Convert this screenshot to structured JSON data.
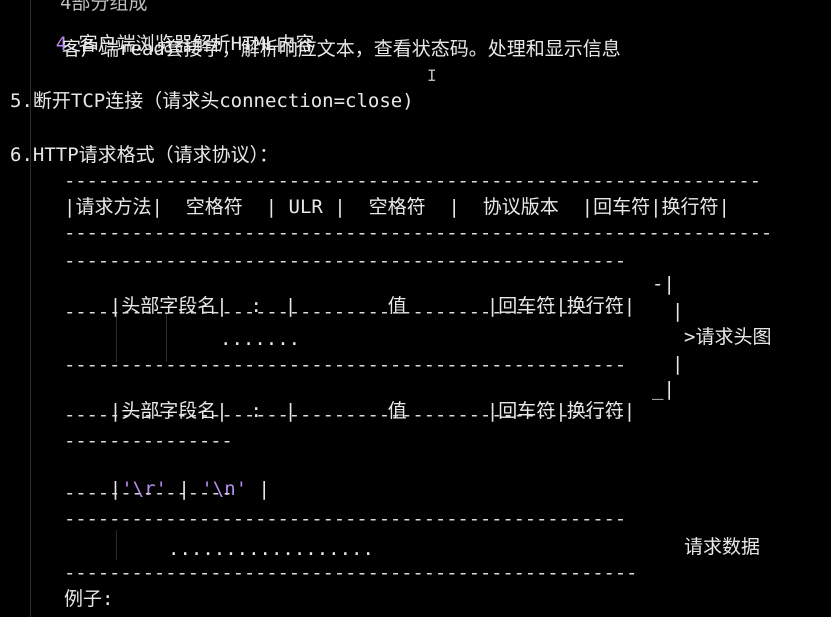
{
  "top_partial": "4部分组成",
  "section4": {
    "number": "4.",
    "title": "客户端浏览器解析HTML内容",
    "body": "客户端read套接字，解析响应文本，查看状态码。处理和显示信息"
  },
  "section5": {
    "text": "5.断开TCP连接（请求头connection=close)"
  },
  "section6": {
    "title": "6.HTTP请求格式（请求协议）："
  },
  "request_line": {
    "cells": "|请求方法|  空格符  | ULR |  空格符  |  协议版本  |回车符|换行符|"
  },
  "header_row_1": {
    "cells": "|头部字段名|  :  |        值       |回车符|换行符|",
    "bracket": "-|"
  },
  "ellipsis_row": {
    "dots": ".......",
    "label": ">请求头图"
  },
  "header_row_2": {
    "cells": "|头部字段名|  :  |        值       |回车符|换行符|",
    "bracket": "_|"
  },
  "crlf_row": {
    "open": "|",
    "cr": "'\\r'",
    "sep": " | ",
    "lf": "'\\n'",
    "close": " |"
  },
  "body_row": {
    "dots": "..................",
    "label": "请求数据"
  },
  "example": {
    "label": "例子:"
  },
  "colors": {
    "accent": "#b58cf0",
    "background": "#000000",
    "text": "#e8e8e8"
  }
}
